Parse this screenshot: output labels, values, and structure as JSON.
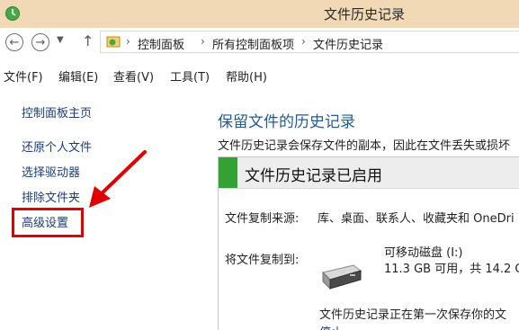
{
  "window": {
    "title": "文件历史记录"
  },
  "address": {
    "crumbs": [
      "控制面板",
      "所有控制面板项",
      "文件历史记录"
    ],
    "separator": "›",
    "dropdown_icon": "chevron-down-icon"
  },
  "menu": {
    "items": [
      "文件(F)",
      "编辑(E)",
      "查看(V)",
      "工具(T)",
      "帮助(H)"
    ]
  },
  "sidebar": {
    "home": "控制面板主页",
    "items": [
      "还原个人文件",
      "选择驱动器",
      "排除文件夹",
      "高级设置"
    ]
  },
  "main": {
    "heading": "保留文件的历史记录",
    "description": "文件历史记录会保存文件的副本，因此在文件丢失或损坏",
    "status_title": "文件历史记录已启用",
    "source_label": "文件复制来源:",
    "source_value": "库、桌面、联系人、收藏夹和 OneDri",
    "dest_label": "将文件复制到:",
    "drive_name": "可移动磁盘 (I:)",
    "drive_space": "11.3 GB 可用，共 14.2 G",
    "progress_text": "文件历史记录正在第一次保存你的文",
    "progress_link": "停止"
  },
  "colors": {
    "titlebar": "#f2d9b5",
    "status_green": "#34a233",
    "heading_blue": "#1f5a99",
    "highlight_red": "#e00000"
  }
}
